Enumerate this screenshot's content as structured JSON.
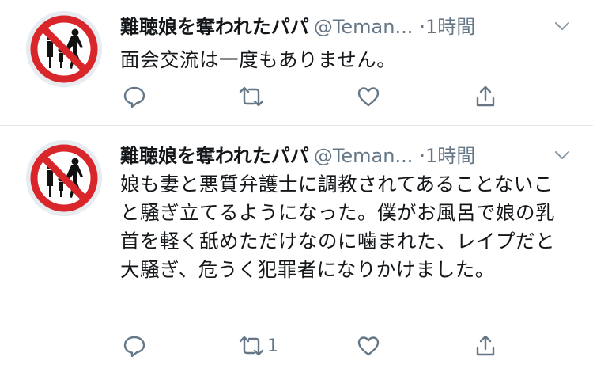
{
  "tweets": [
    {
      "author_name": "難聴娘を奪われたパパ",
      "handle": "@Teman...",
      "time": "·1時間",
      "text": "面会交流は一度もありません。",
      "retweet_count": "",
      "icons": {
        "avatar": "no-taking-child-sign",
        "caret": "chevron-down-icon",
        "reply": "reply-icon",
        "retweet": "retweet-icon",
        "like": "heart-icon",
        "share": "share-icon"
      }
    },
    {
      "author_name": "難聴娘を奪われたパパ",
      "handle": "@Teman...",
      "time": "·1時間",
      "text": "娘も妻と悪質弁護士に調教されてあることないこと騒ぎ立てるようになった。僕がお風呂で娘の乳首を軽く舐めただけなのに噛まれた、レイプだと大騒ぎ、危うく犯罪者になりかけました。",
      "retweet_count": "1",
      "icons": {
        "avatar": "no-taking-child-sign",
        "caret": "chevron-down-icon",
        "reply": "reply-icon",
        "retweet": "retweet-icon",
        "like": "heart-icon",
        "share": "share-icon"
      }
    }
  ],
  "colors": {
    "meta_gray": "#657786",
    "text": "#14171a",
    "sign_red": "#d9262b",
    "divider": "#e1e8ed"
  }
}
